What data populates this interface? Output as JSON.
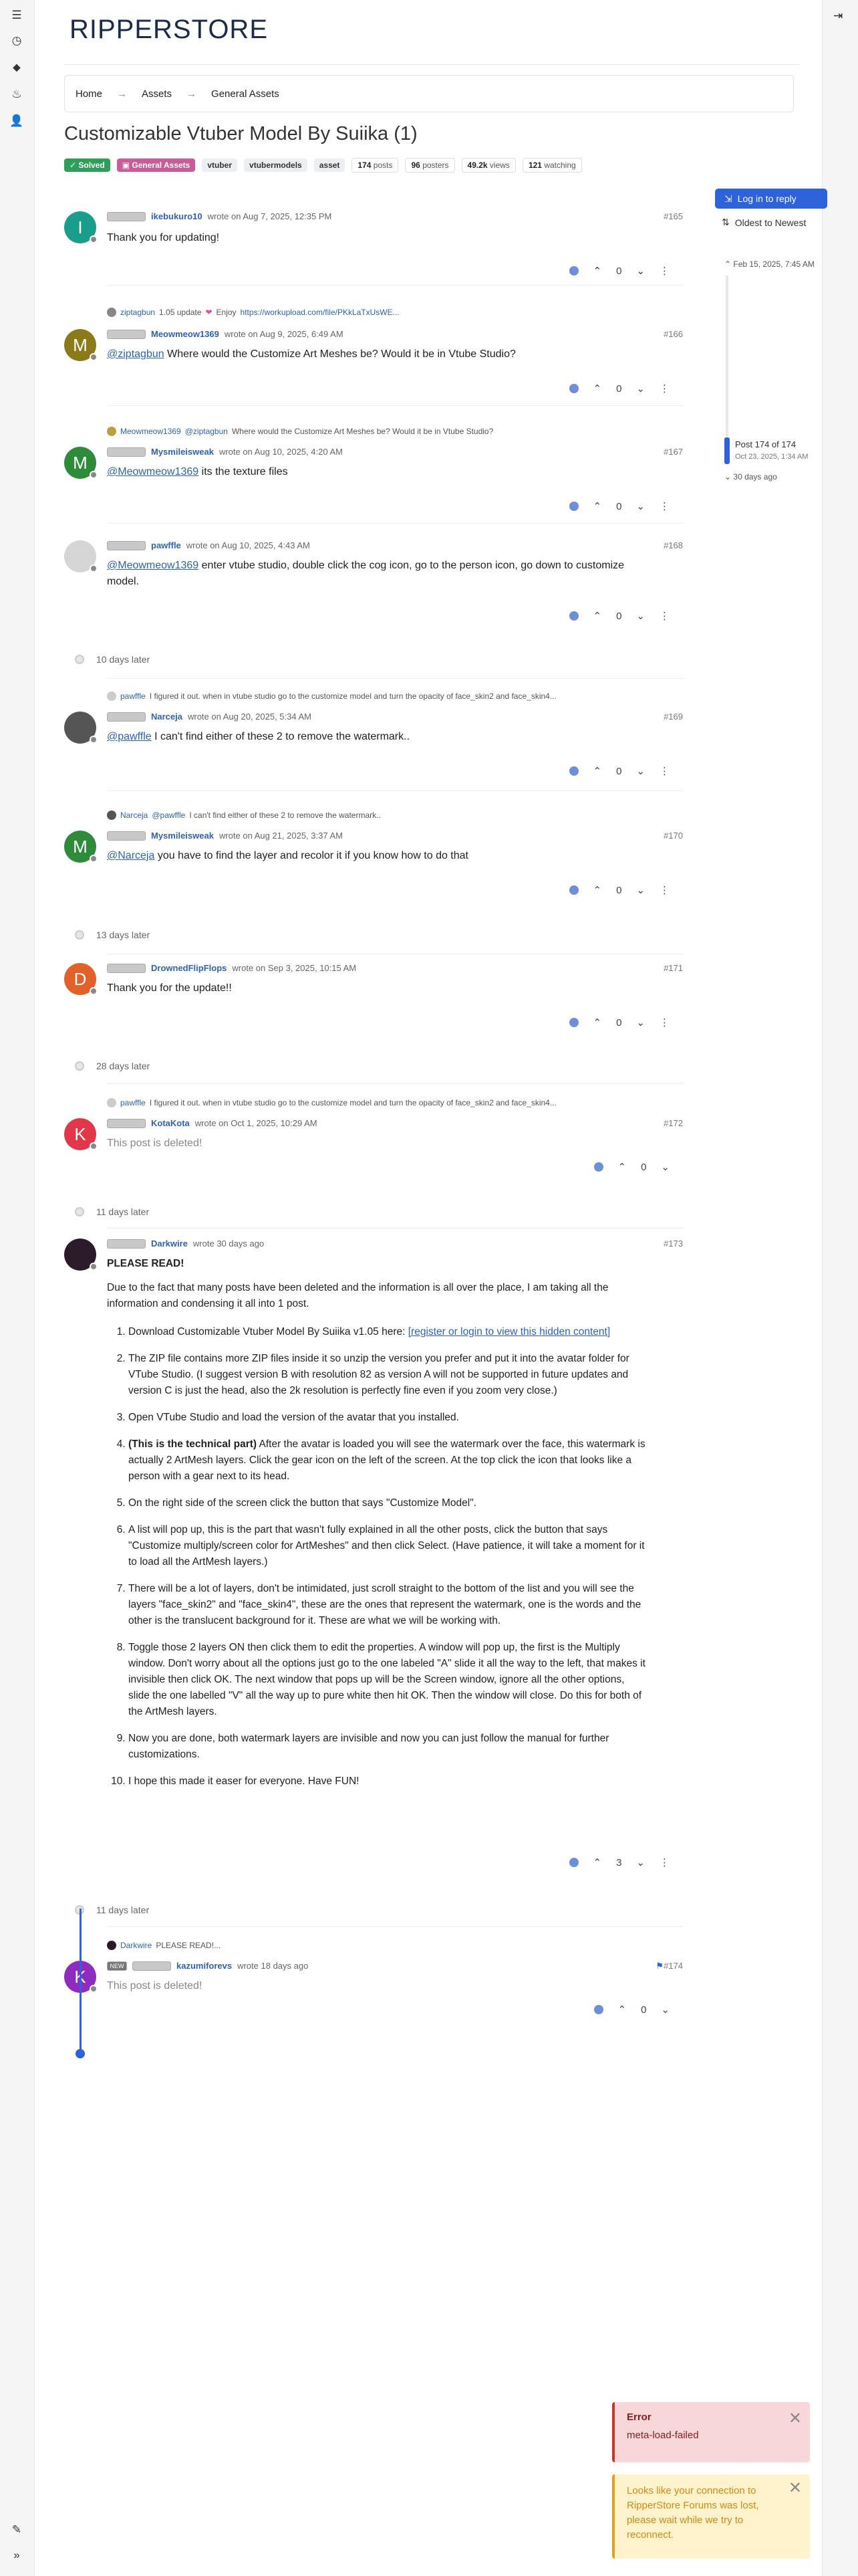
{
  "brand": "RIPPERSTORE",
  "breadcrumb": [
    "Home",
    "Assets",
    "General Assets"
  ],
  "title": "Customizable Vtuber Model By Suiika (1)",
  "tags": {
    "solved": "✓ Solved",
    "category": "General Assets",
    "t1": "vtuber",
    "t2": "vtubermodels",
    "t3": "asset"
  },
  "stats": {
    "posts_n": "174",
    "posts_l": "posts",
    "posters_n": "96",
    "posters_l": "posters",
    "views_n": "49.2k",
    "views_l": "views",
    "watching_n": "121",
    "watching_l": "watching"
  },
  "actions": {
    "reply": "Log in to reply",
    "sort": "Oldest to Newest"
  },
  "timeline": {
    "top": "Feb 15, 2025, 7:45 AM",
    "pos": "Post 174 of 174",
    "pos_date": "Oct 23, 2025, 1:34 AM",
    "bottom": "30 days ago"
  },
  "posts": [
    {
      "user": "ikebukuro10",
      "meta": "wrote on Aug 7, 2025, 12:35 PM",
      "num": "#165",
      "body": "Thank you for updating!",
      "votes": "0",
      "letter": "I"
    },
    {
      "ctx_user": "ziptagbun",
      "ctx_text": "1.05 update",
      "ctx_enjoy": "Enjoy",
      "ctx_link": "https://workupload.com/file/PKkLaTxUsWE...",
      "user": "Meowmeow1369",
      "meta": "wrote on Aug 9, 2025, 6:49 AM",
      "num": "#166",
      "mention": "@ziptagbun",
      "body": "Where would the Customize Art Meshes be? Would it be in Vtube Studio?",
      "votes": "0",
      "letter": "M"
    },
    {
      "ctx_user": "Meowmeow1369",
      "ctx_mention": "@ziptagbun",
      "ctx_text": "Where would the Customize Art Meshes be? Would it be in Vtube Studio?",
      "user": "Mysmileisweak",
      "meta": "wrote on Aug 10, 2025, 4:20 AM",
      "num": "#167",
      "mention": "@Meowmeow1369",
      "body": "its the texture files",
      "votes": "0",
      "letter": "M"
    },
    {
      "user": "pawffle",
      "meta": "wrote on Aug 10, 2025, 4:43 AM",
      "num": "#168",
      "mention": "@Meowmeow1369",
      "body": "enter vtube studio, double click the cog icon, go to the person icon, go down to customize model.",
      "votes": "0"
    },
    {
      "gap": "10 days later"
    },
    {
      "ctx_user": "pawffle",
      "ctx_text": "I figured it out. when in vtube studio go to the customize model and turn the opacity of face_skin2 and face_skin4...",
      "user": "Narceja",
      "meta": "wrote on Aug 20, 2025, 5:34 AM",
      "num": "#169",
      "mention": "@pawffle",
      "body": "I can't find either of these 2 to remove the watermark..",
      "votes": "0"
    },
    {
      "ctx_user": "Narceja",
      "ctx_mention": "@pawffle",
      "ctx_text": "I can't find either of these 2 to remove the watermark..",
      "user": "Mysmileisweak",
      "meta": "wrote on Aug 21, 2025, 3:37 AM",
      "num": "#170",
      "mention": "@Narceja",
      "body": "you have to find the layer and recolor it if you know how to do that",
      "votes": "0",
      "letter": "M"
    },
    {
      "gap": "13 days later"
    },
    {
      "user": "DrownedFlipFlops",
      "meta": "wrote on Sep 3, 2025, 10:15 AM",
      "num": "#171",
      "body": "Thank you for the update!!",
      "votes": "0",
      "letter": "D"
    },
    {
      "gap": "28 days later"
    },
    {
      "ctx_user": "pawffle",
      "ctx_text": "I figured it out. when in vtube studio go to the customize model and turn the opacity of face_skin2 and face_skin4...",
      "user": "KotaKota",
      "meta": "wrote on Oct 1, 2025, 10:29 AM",
      "num": "#172",
      "body": "This post is deleted!",
      "votes": "0",
      "letter": "K"
    },
    {
      "gap": "11 days later"
    },
    {
      "user": "Darkwire",
      "meta": "wrote 30 days ago",
      "num": "#173",
      "votes": "3",
      "heading": "PLEASE READ!",
      "intro": "Due to the fact that many posts have been deleted and the information is all over the place, I am taking all the information and condensing it all into 1 post.",
      "steps": [
        "Download Customizable Vtuber Model By Suiika v1.05 here: ",
        "The ZIP file contains more ZIP files inside it so unzip the version you prefer and put it into the avatar folder for VTube Studio. (I suggest version B with resolution 82 as version A will not be supported in future updates and version C is just the head, also the 2k resolution is perfectly fine even if you zoom very close.)",
        "Open VTube Studio and load the version of the avatar that you installed.",
        "After the avatar is loaded you will see the watermark over the face, this watermark is actually 2 ArtMesh layers. Click the gear icon on the left of the screen. At the top click the icon that looks like a person with a gear next to its head.",
        "On the right side of the screen click the button that says \"Customize Model\".",
        "A list will pop up, this is the part that wasn't fully explained in all the other posts, click the button that says \"Customize multiply/screen color for ArtMeshes\" and then click Select. (Have patience, it will take a moment for it to load all the ArtMesh layers.)",
        "There will be a lot of layers, don't be intimidated, just scroll straight to the bottom of the list and you will see the layers \"face_skin2\" and \"face_skin4\", these are the ones that represent the watermark, one is the words and the other is the translucent background for it. These are what we will be working with.",
        "Toggle those 2 layers ON then click them to edit the properties. A window will pop up, the first is the Multiply window. Don't worry about all the options just go to the one labeled \"A\" slide it all the way to the left, that makes it invisible then click OK. The next window that pops up will be the Screen window, ignore all the other options, slide the one labelled \"V\" all the way up to pure white then hit OK. Then the window will close. Do this for both of the ArtMesh layers.",
        "Now you are done, both watermark layers are invisible and now you can just follow the manual for further customizations.",
        "I hope this made it easer for everyone. Have FUN!"
      ],
      "link": "[register or login to view this hidden content]",
      "step4_bold": "(This is the technical part)"
    },
    {
      "gap": "11 days later"
    },
    {
      "ctx_user": "Darkwire",
      "ctx_text": "PLEASE READ!...",
      "user": "kazumiforevs",
      "meta": "wrote 18 days ago",
      "num": "#174",
      "new": "NEW",
      "body": "This post is deleted!",
      "votes": "0",
      "letter": "K"
    }
  ],
  "toasts": {
    "err_title": "Error",
    "err_msg": "meta-load-failed",
    "warn_msg": "Looks like your connection to RipperStore Forums was lost, please wait while we try to reconnect."
  },
  "colors": {
    "accent": "#2e62d9",
    "solved": "#2e9f5b",
    "category": "#c95b97"
  }
}
